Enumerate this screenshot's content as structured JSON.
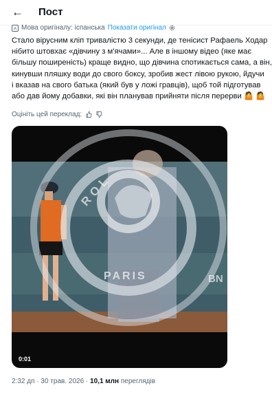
{
  "header": {
    "title": "Пост"
  },
  "translation": {
    "original_language": "Мова оригіналу: іспанська",
    "show_original": "Показати оригінал"
  },
  "tweet": {
    "lines": [
      "Стало вірусним кліп тривалістю 3 секунди, де тенісист Рафаель Ходар",
      "нібито штовхає «дівчину з м'ячами»... Але в іншому відео (яке має",
      "більшу поширеність) краще видно, що дівчина спотикається сама, а він,",
      "кинувши пляшку води до свого боксу, зробив жест лівою рукою, йдучи",
      "і вказав на свого батька (який був у ложі гравців), щоб той підготував",
      "або дав йому добавки, які він планував прийняти після перерви"
    ],
    "emoji": "🤷 🤷"
  },
  "rating": {
    "label": "Оцініть цей переклад:"
  },
  "video": {
    "timestamp": "0:01",
    "brand_letters": "ROL",
    "city": "PARIS",
    "partner": "BN"
  },
  "meta": {
    "time": "2:32 дп",
    "separator": "·",
    "date": "30 трав. 2026",
    "views_count": "10,1 млн",
    "views_label": "переглядів"
  },
  "colors": {
    "accent": "#1d9bf0",
    "muted": "#536471",
    "text": "#0f1419",
    "court_orange": "#c75a1e"
  }
}
